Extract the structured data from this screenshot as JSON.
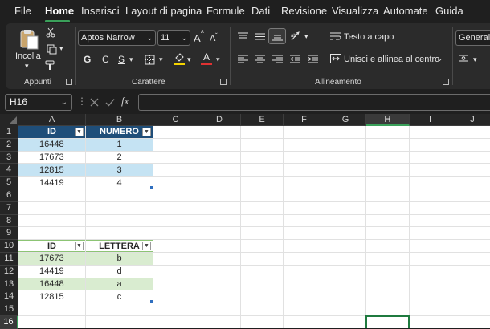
{
  "menu": {
    "items": [
      "File",
      "Home",
      "Inserisci",
      "Layout di pagina",
      "Formule",
      "Dati",
      "Revisione",
      "Visualizza",
      "Automate",
      "Guida"
    ],
    "active": "Home"
  },
  "ribbon": {
    "clipboard": {
      "paste_label": "Incolla",
      "group_label": "Appunti"
    },
    "font": {
      "font_name": "Aptos Narrow",
      "font_size": "11",
      "bold": "G",
      "italic": "C",
      "underline": "S",
      "grow": "A",
      "shrink": "A",
      "group_label": "Carattere",
      "fill_color": "#f5d400",
      "font_color": "#e03232"
    },
    "alignment": {
      "wrap_label": "Testo a capo",
      "merge_label": "Unisci e allinea al centro",
      "group_label": "Allineamento"
    },
    "number": {
      "format": "Generale"
    }
  },
  "formula_bar": {
    "name_box": "H16",
    "fx_label": "fx",
    "value": ""
  },
  "grid": {
    "columns": [
      "A",
      "B",
      "C",
      "D",
      "E",
      "F",
      "G",
      "H",
      "I",
      "J"
    ],
    "selected_column": "H",
    "rows": [
      "1",
      "2",
      "3",
      "4",
      "5",
      "6",
      "7",
      "8",
      "9",
      "10",
      "11",
      "12",
      "13",
      "14",
      "15",
      "16"
    ],
    "selected_row": "16",
    "selected_cell": "H16"
  },
  "table1": {
    "headers": [
      "ID",
      "NUMERO"
    ],
    "rows": [
      [
        "16448",
        "1"
      ],
      [
        "17673",
        "2"
      ],
      [
        "12815",
        "3"
      ],
      [
        "14419",
        "4"
      ]
    ],
    "header_color": "#1f4e79",
    "band_color": "#c5e3f3"
  },
  "table2": {
    "headers": [
      "ID",
      "LETTERA"
    ],
    "rows": [
      [
        "17673",
        "b"
      ],
      [
        "14419",
        "d"
      ],
      [
        "16448",
        "a"
      ],
      [
        "12815",
        "c"
      ]
    ],
    "band_color": "#d9ecd0"
  }
}
